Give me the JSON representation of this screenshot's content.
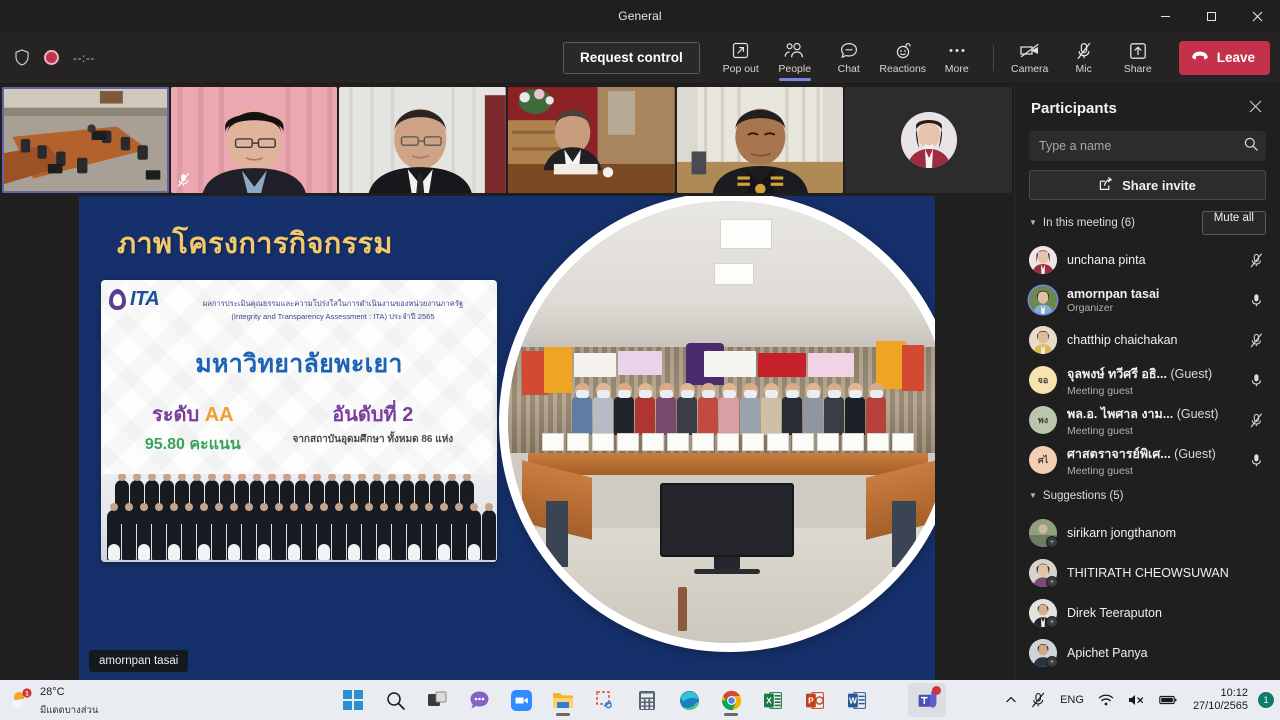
{
  "window": {
    "title": "General",
    "minimize_label": "Minimize",
    "maximize_label": "Restore",
    "close_label": "Close"
  },
  "toolbar": {
    "timer": "--:--",
    "request_control_label": "Request control",
    "items": [
      {
        "label": "Pop out",
        "icon": "pop-out-icon"
      },
      {
        "label": "People",
        "icon": "people-icon"
      },
      {
        "label": "Chat",
        "icon": "chat-icon"
      },
      {
        "label": "Reactions",
        "icon": "reactions-icon"
      },
      {
        "label": "More",
        "icon": "more-icon"
      },
      {
        "label": "Camera",
        "icon": "camera-off-icon"
      },
      {
        "label": "Mic",
        "icon": "mic-off-icon"
      },
      {
        "label": "Share",
        "icon": "share-icon"
      }
    ],
    "leave_label": "Leave",
    "accent_color": "#7b83eb",
    "leave_color": "#c4314b"
  },
  "filmstrip": {
    "tiles": [
      {
        "name": "meeting-room-tile",
        "muted": false,
        "selected": true
      },
      {
        "name": "participant-tile-2",
        "muted": true,
        "selected": false
      },
      {
        "name": "participant-tile-3",
        "muted": false,
        "selected": false
      },
      {
        "name": "participant-tile-4",
        "muted": false,
        "selected": false
      },
      {
        "name": "participant-tile-5",
        "muted": false,
        "selected": false
      },
      {
        "name": "participant-avatar-tile",
        "muted": false,
        "selected": false
      }
    ]
  },
  "share": {
    "presenter_badge": "amornpan tasai",
    "slide": {
      "title": "ภาพโครงการกิจกรรม",
      "card": {
        "logo_text": "ITA",
        "subtitle_line1": "ผลการประเมินคุณธรรมและความโปร่งใสในการดำเนินงานของหน่วยงานภาครัฐ",
        "subtitle_line2": "(Integrity and Transparency Assessment : ITA) ประจำปี 2565",
        "organization": "มหาวิทยาลัยพะเยา",
        "stat_left_label": "ระดับ",
        "stat_left_value": "AA",
        "stat_left_sub": "95.80 คะแนน",
        "stat_right_label": "อันดับที่ 2",
        "stat_right_sub": "จากสถาบันอุดมศึกษา ทั้งหมด 86 แห่ง"
      }
    }
  },
  "participants": {
    "title": "Participants",
    "close_label": "Close",
    "search_placeholder": "Type a name",
    "search_value": "",
    "share_invite_label": "Share invite",
    "in_meeting_label": "In this meeting (6)",
    "mute_all_label": "Mute all",
    "suggestions_label": "Suggestions (5)",
    "in_meeting": [
      {
        "name": "unchana pinta",
        "sub": "",
        "guest": false,
        "muted": true,
        "organizer": false,
        "avatar_color": "#c08a96"
      },
      {
        "name": "amornpan tasai",
        "sub": "Organizer",
        "guest": false,
        "muted": false,
        "organizer": true,
        "avatar_color": "#5a7a4c"
      },
      {
        "name": "chatthip chaichakan",
        "sub": "",
        "guest": false,
        "muted": true,
        "organizer": false,
        "avatar_color": "#c9a96a"
      },
      {
        "name": "จุลพงษ์ ทวีศรี อธิ...",
        "sub": "Meeting guest",
        "guest": true,
        "guest_tag": "(Guest)",
        "initials": "จอ",
        "muted": false,
        "avatar_color": "#f7e3b0"
      },
      {
        "name": "พล.อ. ไพศาล งาม...",
        "sub": "Meeting guest",
        "guest": true,
        "guest_tag": "(Guest)",
        "initials": "พง",
        "muted": true,
        "avatar_color": "#b9c5ad"
      },
      {
        "name": "ศาสตราจารย์พิเศ...",
        "sub": "Meeting guest",
        "guest": true,
        "guest_tag": "(Guest)",
        "initials": "ศไ",
        "muted": false,
        "avatar_color": "#f3cdb4"
      }
    ],
    "suggestions": [
      {
        "name": "sirikarn jongthanom",
        "avatar_color": "#7d8a6e"
      },
      {
        "name": "THITIRATH CHEOWSUWAN",
        "avatar_color": "#9b7f8c"
      },
      {
        "name": "Direk Teeraputon",
        "avatar_color": "#8a8f96"
      },
      {
        "name": "Apichet Panya",
        "avatar_color": "#6f7d8c"
      }
    ]
  },
  "taskbar": {
    "weather_temp": "28°C",
    "weather_desc": "มีแดดบางส่วน",
    "weather_badge": "1",
    "apps": [
      {
        "name": "start-button",
        "label": "Start"
      },
      {
        "name": "search-button",
        "label": "Search"
      },
      {
        "name": "task-view-button",
        "label": "Task view"
      },
      {
        "name": "chat-app",
        "label": "Chat"
      },
      {
        "name": "zoom-app",
        "label": "Zoom"
      },
      {
        "name": "file-explorer-app",
        "label": "File Explorer"
      },
      {
        "name": "snipping-tool-app",
        "label": "Snipping Tool"
      },
      {
        "name": "calculator-app",
        "label": "Calculator"
      },
      {
        "name": "edge-app",
        "label": "Microsoft Edge"
      },
      {
        "name": "chrome-app",
        "label": "Google Chrome"
      },
      {
        "name": "excel-app",
        "label": "Excel"
      },
      {
        "name": "powerpoint-app",
        "label": "PowerPoint"
      },
      {
        "name": "word-app",
        "label": "Word"
      },
      {
        "name": "teams-app",
        "label": "Microsoft Teams"
      }
    ],
    "tray": {
      "language": "ENG",
      "time": "10:12",
      "date": "27/10/2565",
      "notification_count": "1"
    }
  }
}
